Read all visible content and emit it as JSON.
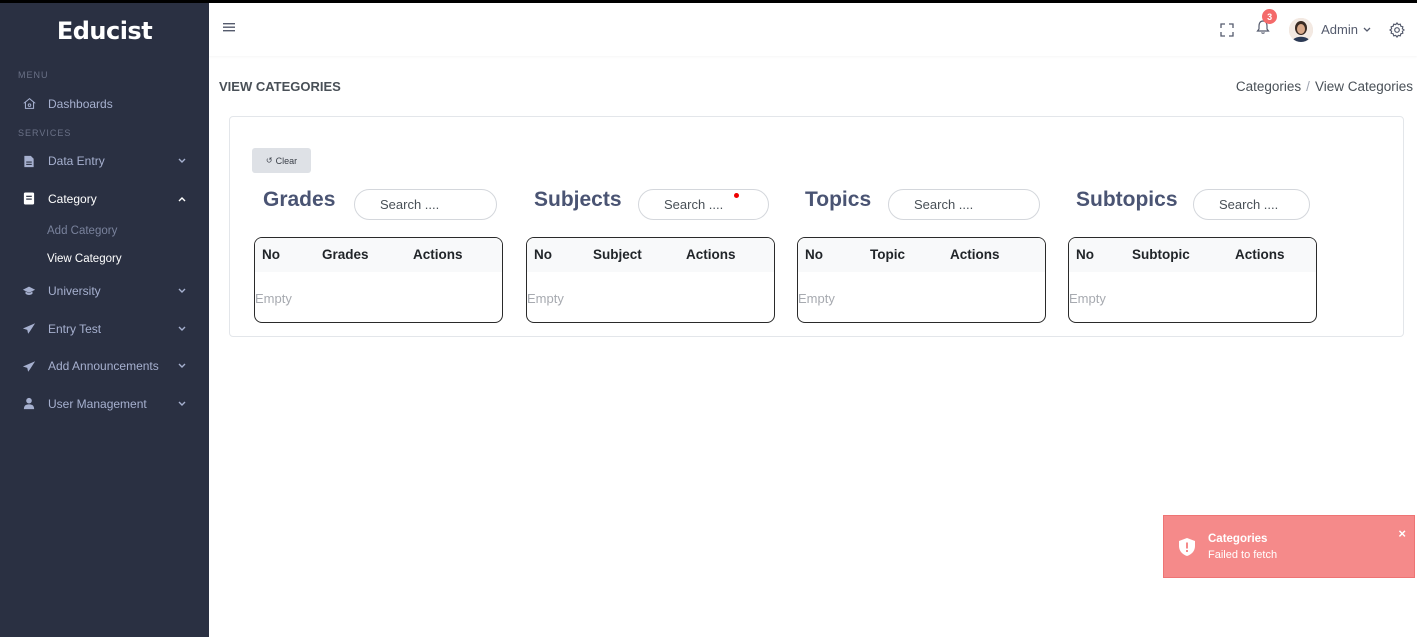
{
  "app": {
    "brand": "Educist"
  },
  "sidebar": {
    "menu_title": "MENU",
    "services_title": "SERVICES",
    "dashboards": "Dashboards",
    "items": [
      {
        "label": "Data Entry"
      },
      {
        "label": "Category"
      },
      {
        "label": "University"
      },
      {
        "label": "Entry Test"
      },
      {
        "label": "Add Announcements"
      },
      {
        "label": "User Management"
      }
    ],
    "category_sub": [
      {
        "label": "Add Category"
      },
      {
        "label": "View Category"
      }
    ]
  },
  "topbar": {
    "notification_count": "3",
    "user_name": "Admin"
  },
  "page": {
    "title": "VIEW CATEGORIES",
    "breadcrumb": [
      "Categories",
      "View Categories"
    ],
    "breadcrumb_sep": "/",
    "clear_label": "Clear"
  },
  "sections": [
    {
      "title": "Grades",
      "search_placeholder": "Search ....",
      "columns": [
        "No",
        "Grades",
        "Actions"
      ],
      "empty": "Empty"
    },
    {
      "title": "Subjects",
      "search_placeholder": "Search ....",
      "columns": [
        "No",
        "Subject",
        "Actions"
      ],
      "empty": "Empty"
    },
    {
      "title": "Topics",
      "search_placeholder": "Search ....",
      "columns": [
        "No",
        "Topic",
        "Actions"
      ],
      "empty": "Empty"
    },
    {
      "title": "Subtopics",
      "search_placeholder": "Search ....",
      "columns": [
        "No",
        "Subtopic",
        "Actions"
      ],
      "empty": "Empty"
    }
  ],
  "toast": {
    "title": "Categories",
    "message": "Failed to fetch",
    "close": "×"
  },
  "colors": {
    "sidebar_bg": "#2a3042",
    "toast_bg": "#f58a8a",
    "badge": "#f46a6a",
    "section_title": "#4a5473"
  }
}
